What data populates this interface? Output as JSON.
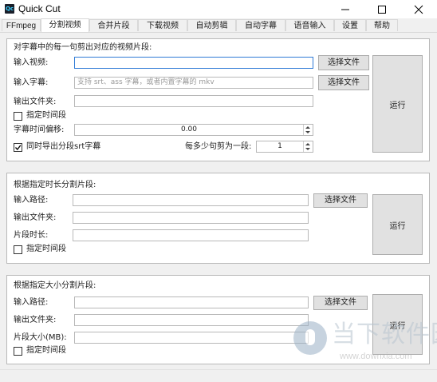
{
  "window": {
    "title": "Quick Cut",
    "icon_text": "Qc",
    "controls": [
      "minimize-icon",
      "maximize-icon",
      "close-icon"
    ]
  },
  "tabs": [
    {
      "label": "FFmpeg",
      "active": false
    },
    {
      "label": "分割视频",
      "active": true
    },
    {
      "label": "合并片段",
      "active": false
    },
    {
      "label": "下载视频",
      "active": false
    },
    {
      "label": "自动剪辑",
      "active": false
    },
    {
      "label": "自动字幕",
      "active": false
    },
    {
      "label": "语音输入",
      "active": false
    },
    {
      "label": "设置",
      "active": false
    },
    {
      "label": "帮助",
      "active": false
    }
  ],
  "section1": {
    "title": "对字幕中的每一句剪出对应的视频片段:",
    "video_label": "输入视频:",
    "video_value": "",
    "subtitle_label": "输入字幕:",
    "subtitle_placeholder": "支持 srt、ass 字幕，或者内置字幕的 mkv",
    "output_label": "输出文件夹:",
    "output_value": "",
    "select_file_label": "选择文件",
    "time_range_label": "指定时间段",
    "time_range_checked": false,
    "offset_label": "字幕时间偏移:",
    "offset_value": "0.00",
    "export_srt_label": "同时导出分段srt字幕",
    "export_srt_checked": true,
    "per_segment_label": "每多少句剪为一段:",
    "per_segment_value": "1",
    "run_label": "运行"
  },
  "section2": {
    "title": "根据指定时长分割片段:",
    "input_label": "输入路径:",
    "output_label": "输出文件夹:",
    "duration_label": "片段时长:",
    "select_file_label": "选择文件",
    "time_range_label": "指定时间段",
    "time_range_checked": false,
    "run_label": "运行"
  },
  "section3": {
    "title": "根据指定大小分割片段:",
    "input_label": "输入路径:",
    "output_label": "输出文件夹:",
    "size_label": "片段大小(MB):",
    "select_file_label": "选择文件",
    "time_range_label": "指定时间段",
    "time_range_checked": false,
    "run_label": "运行"
  },
  "watermark": {
    "text": "当下软件园",
    "url": "www.downxia.com"
  },
  "colors": {
    "accent_focus": "#2f7bd6",
    "button_bg": "#e1e1e1",
    "panel_bg": "#ffffff",
    "window_bg": "#f0f0f0"
  }
}
